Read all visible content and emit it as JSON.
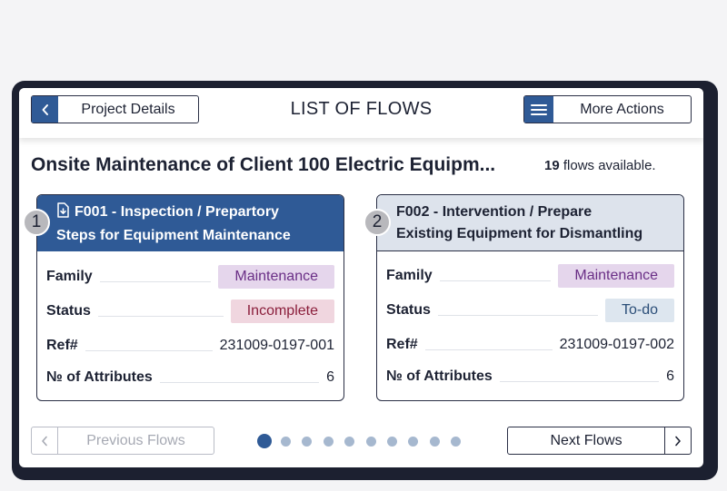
{
  "header": {
    "back_label": "Project Details",
    "title": "LIST OF FLOWS",
    "more_label": "More Actions"
  },
  "project": {
    "name": "Onsite Maintenance of Client 100 Electric Equipm...",
    "flows_count": "19",
    "flows_suffix": "flows available."
  },
  "cards": [
    {
      "index": "1",
      "title_line1": "F001 - Inspection / Prepartory",
      "title_line2": "Steps for Equipment Maintenance",
      "family_label": "Family",
      "family_value": "Maintenance",
      "status_label": "Status",
      "status_value": "Incomplete",
      "ref_label": "Ref#",
      "ref_value": "231009-0197-001",
      "attrs_label": "№ of Attributes",
      "attrs_value": "6",
      "selected": true
    },
    {
      "index": "2",
      "title_line1": "F002 -  Intervention / Prepare",
      "title_line2": "Existing Equipment for Dismantling",
      "family_label": "Family",
      "family_value": "Maintenance",
      "status_label": "Status",
      "status_value": "To-do",
      "ref_label": "Ref#",
      "ref_value": "231009-0197-002",
      "attrs_label": "№ of Attributes",
      "attrs_value": "6",
      "selected": false
    }
  ],
  "pagination": {
    "prev_label": "Previous Flows",
    "next_label": "Next Flows",
    "page_count": 10,
    "current_page": 1
  },
  "colors": {
    "accent": "#2f5a96",
    "device_frame": "#1c2030",
    "family_pill": "#e5d6ec",
    "incomplete_pill": "#f0d6df",
    "todo_pill": "#dde6ef"
  },
  "icons": {
    "back": "chevron-left-icon",
    "menu": "hamburger-menu-icon",
    "document": "document-download-icon",
    "next": "chevron-right-icon"
  }
}
